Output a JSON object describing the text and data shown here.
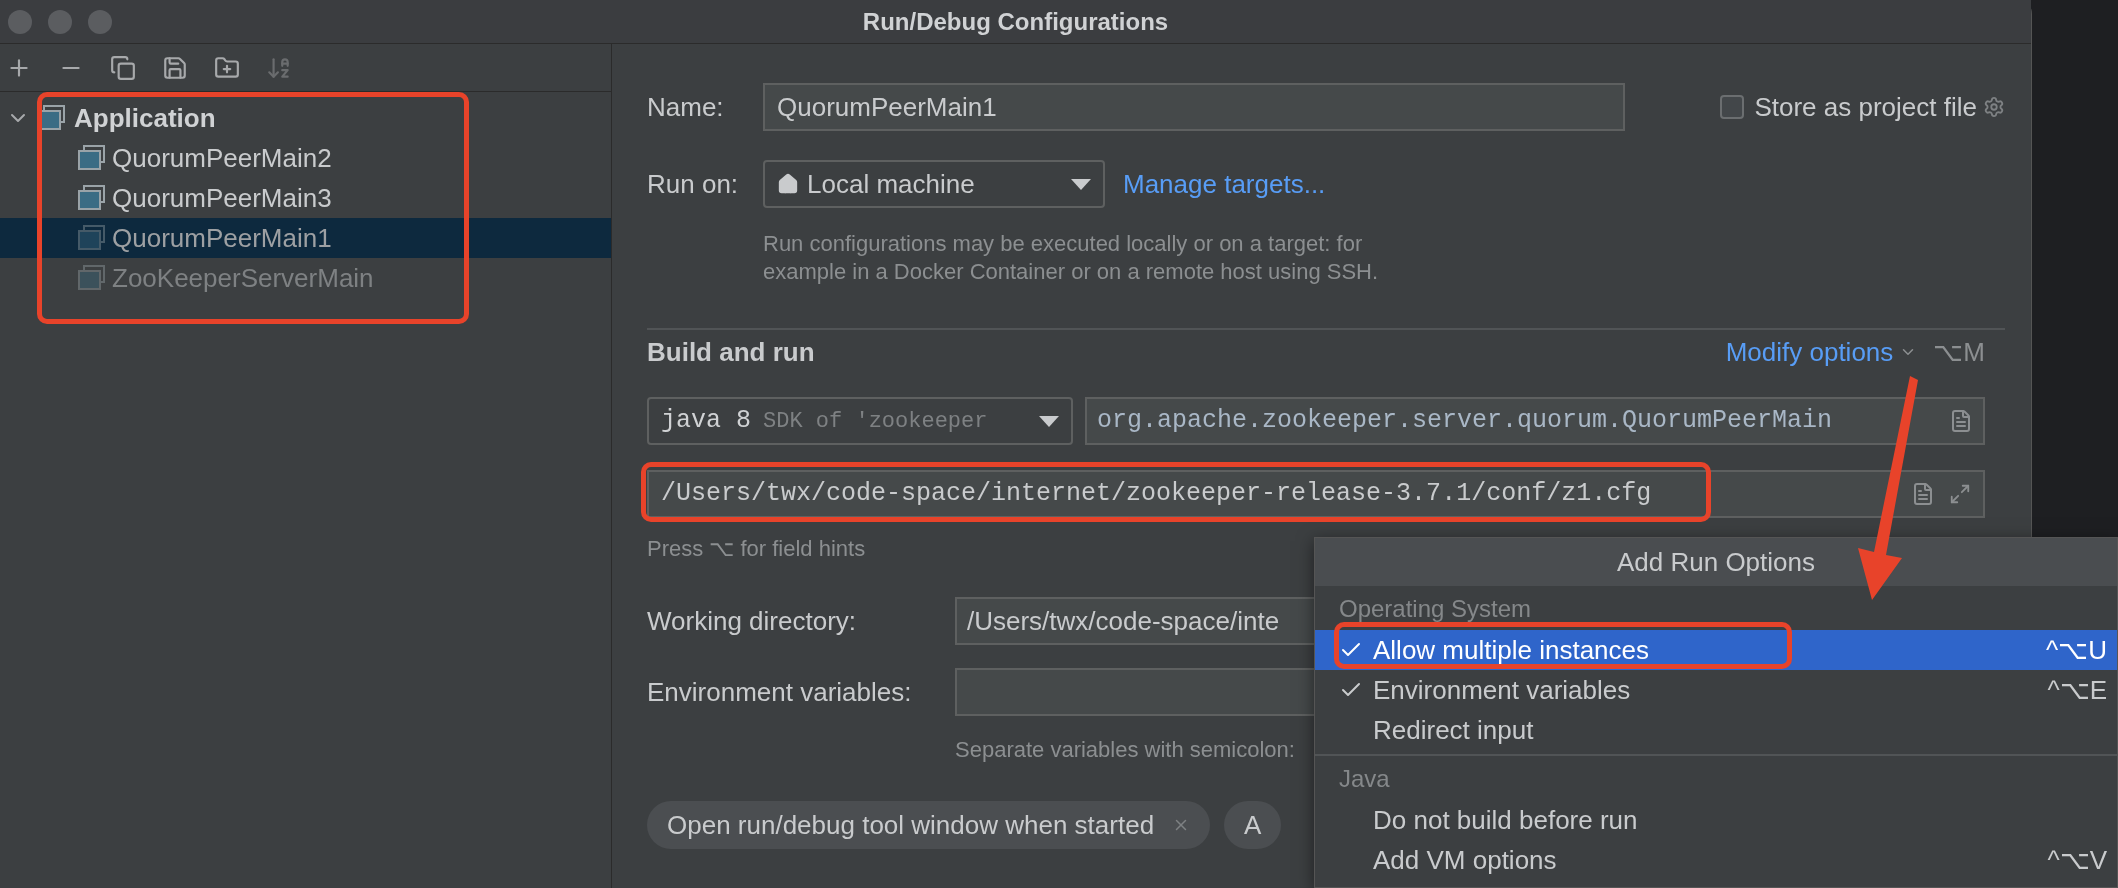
{
  "window": {
    "title": "Run/Debug Configurations"
  },
  "tree": {
    "label": "Application",
    "expanded": true,
    "children": [
      {
        "label": "QuorumPeerMain2",
        "selected": false,
        "temporary": false
      },
      {
        "label": "QuorumPeerMain3",
        "selected": false,
        "temporary": false
      },
      {
        "label": "QuorumPeerMain1",
        "selected": true,
        "temporary": false
      },
      {
        "label": "ZooKeeperServerMain",
        "selected": false,
        "temporary": true
      }
    ]
  },
  "form": {
    "name_label": "Name:",
    "name_value": "QuorumPeerMain1",
    "store_label": "Store as project file",
    "store_checked": false,
    "run_on_label": "Run on:",
    "run_on_value": "Local machine",
    "manage_link": "Manage targets...",
    "run_on_help": "Run configurations may be executed locally or on a target: for example in a Docker Container or on a remote host using SSH.",
    "section": "Build and run",
    "modify_link": "Modify options",
    "modify_shortcut": "⌥M",
    "sdk_main": "java 8",
    "sdk_rest": "SDK of 'zookeeper",
    "main_class": "org.apache.zookeeper.server.quorum.QuorumPeerMain",
    "program_args": "/Users/twx/code-space/internet/zookeeper-release-3.7.1/conf/z1.cfg",
    "field_hint": "Press ⌥ for field hints",
    "workdir_label": "Working directory:",
    "workdir_value": "/Users/twx/code-space/inte",
    "env_label": "Environment variables:",
    "env_help": "Separate variables with semicolon:",
    "chips": [
      "Open run/debug tool window when started",
      "A"
    ]
  },
  "popup": {
    "title": "Add Run Options",
    "sections": [
      {
        "header": "Operating System",
        "items": [
          {
            "label": "Allow multiple instances",
            "checked": true,
            "selected": true,
            "shortcut": "^⌥U"
          },
          {
            "label": "Environment variables",
            "checked": true,
            "selected": false,
            "shortcut": "^⌥E"
          },
          {
            "label": "Redirect input",
            "checked": false,
            "selected": false
          }
        ]
      },
      {
        "header": "Java",
        "items": [
          {
            "label": "Do not build before run",
            "checked": false,
            "selected": false
          },
          {
            "label": "Add VM options",
            "checked": false,
            "selected": false,
            "shortcut": "^⌥V"
          }
        ]
      }
    ]
  }
}
